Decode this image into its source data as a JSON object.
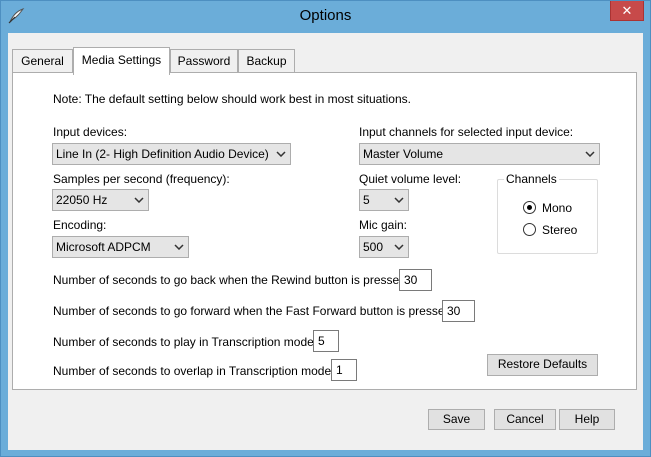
{
  "window": {
    "title": "Options",
    "close_glyph": "✕"
  },
  "tabs": [
    {
      "label": "General",
      "active": false
    },
    {
      "label": "Media Settings",
      "active": true
    },
    {
      "label": "Password",
      "active": false
    },
    {
      "label": "Backup",
      "active": false
    }
  ],
  "media": {
    "note": "Note: The default setting below should work best in most situations.",
    "input_devices_label": "Input devices:",
    "input_devices_value": "Line In (2- High Definition Audio Device)",
    "input_channels_label": "Input channels for selected input device:",
    "input_channels_value": "Master Volume",
    "samples_label": "Samples per second (frequency):",
    "samples_value": "22050 Hz",
    "quiet_label": "Quiet volume level:",
    "quiet_value": "5",
    "encoding_label": "Encoding:",
    "encoding_value": "Microsoft ADPCM",
    "mic_gain_label": "Mic gain:",
    "mic_gain_value": "500",
    "channels": {
      "title": "Channels",
      "mono_label": "Mono",
      "stereo_label": "Stereo",
      "selected": "Mono"
    },
    "rewind_label": "Number of seconds to go back when the Rewind button is pressed:",
    "rewind_value": "30",
    "ffwd_label": "Number of seconds to go forward when the Fast Forward button is pressed:",
    "ffwd_value": "30",
    "play_label": "Number of seconds to play in Transcription mode:",
    "play_value": "5",
    "overlap_label": "Number of seconds to overlap in Transcription mode:",
    "overlap_value": "1",
    "restore_defaults_label": "Restore Defaults"
  },
  "footer": {
    "save_label": "Save",
    "cancel_label": "Cancel",
    "help_label": "Help"
  },
  "colors": {
    "frame": "#6badd9",
    "close": "#c74a4a",
    "client": "#f0f0f0"
  }
}
